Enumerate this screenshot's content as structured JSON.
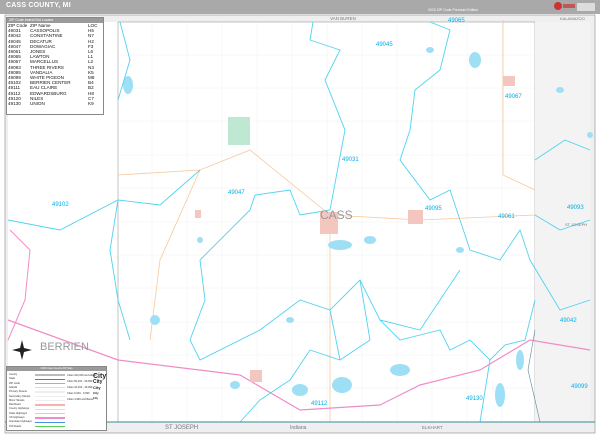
{
  "header": {
    "title": "CASS COUNTY, MI",
    "edition": "2020 ZIP Code Premium Edition",
    "logo_text": "MarketMAPS"
  },
  "zip_table": {
    "title": "ZIP Code Index/Grid Locator",
    "columns": [
      "ZIP Code",
      "ZIP Name",
      "LOC"
    ],
    "rows": [
      [
        "49031",
        "CASSOPOLIS",
        "H5"
      ],
      [
        "49042",
        "CONSTANTINE",
        "N7"
      ],
      [
        "49045",
        "DECATUR",
        "H2"
      ],
      [
        "49047",
        "DOWAGIAC",
        "F3"
      ],
      [
        "49061",
        "JONES",
        "L6"
      ],
      [
        "49065",
        "LAWTON",
        "L1"
      ],
      [
        "49067",
        "MARCELLUS",
        "L2"
      ],
      [
        "49093",
        "THREE RIVERS",
        "N3"
      ],
      [
        "49095",
        "VANDALIA",
        "K5"
      ],
      [
        "49099",
        "WHITE PIGEON",
        "M8"
      ],
      [
        "49102",
        "BERRIEN CENTER",
        "B4"
      ],
      [
        "49111",
        "EAU CLAIRE",
        "B2"
      ],
      [
        "49112",
        "EDWARDSBURG",
        "H8"
      ],
      [
        "49120",
        "NILES",
        "C7"
      ],
      [
        "49130",
        "UNION",
        "K9"
      ]
    ]
  },
  "map_labels": {
    "county": "CASS",
    "berrien": "BERRIEN",
    "van_buren": "VAN BUREN",
    "kalamazoo": "KALAMAZOO",
    "st_joseph_right": "ST JOSEPH",
    "st_joseph_bottom": "ST JOSEPH",
    "indiana": "Indiana",
    "elkhart": "ELKHART",
    "zips": [
      "49045",
      "49065",
      "49067",
      "49102",
      "49047",
      "49031",
      "49095",
      "49061",
      "49093",
      "49042",
      "49099",
      "49112",
      "49130"
    ]
  },
  "legend": {
    "title": "2020 Cass County ZIP Map",
    "lines": [
      "County",
      "State",
      "ZIP Code",
      "Islands",
      "Primary Streets",
      "Secondary Streets",
      "Minor Streets",
      "Rail Road",
      "County Highways",
      "State Highways",
      "US Highways",
      "Interstate Highways",
      "Toll Roads"
    ],
    "cities": [
      [
        "Cities 100,000 and Above",
        "City"
      ],
      [
        "Cities 50,000 - 99,999",
        "City"
      ],
      [
        "Cities 10,000 - 49,999",
        "City"
      ],
      [
        "Cities 5,000 - 9,999",
        "City"
      ],
      [
        "Cities 4,999 and Below",
        "City"
      ]
    ]
  },
  "colors": {
    "zip": "#4fd3f0",
    "water": "#9edff5",
    "highway": "#f08cc8",
    "county_road": "#f5c99a",
    "city": "#f4c6c0",
    "header": "#a9a9a9"
  }
}
